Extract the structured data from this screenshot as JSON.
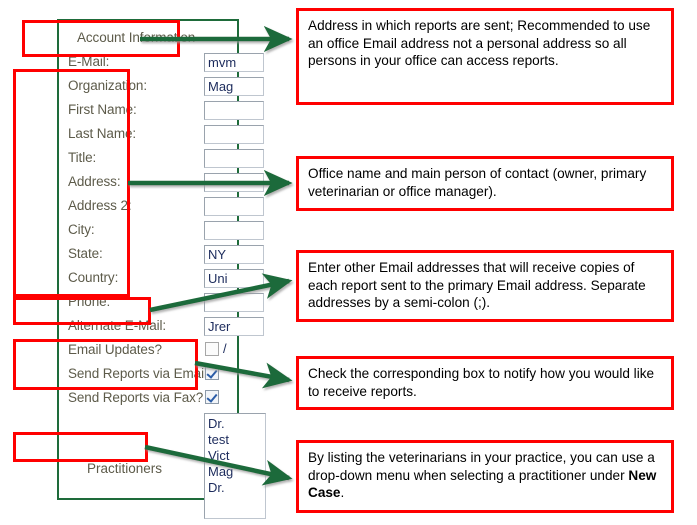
{
  "form": {
    "section_account": "Account Information",
    "section_practitioners": "Practitioners",
    "rows": [
      {
        "label": "E-Mail:",
        "value": "mvm",
        "type": "text"
      },
      {
        "label": "Organization:",
        "value": "Mag",
        "type": "text"
      },
      {
        "label": "First Name:",
        "value": "",
        "type": "text"
      },
      {
        "label": "Last Name:",
        "value": "",
        "type": "text"
      },
      {
        "label": "Title:",
        "value": "",
        "type": "text"
      },
      {
        "label": "Address:",
        "value": "",
        "type": "text"
      },
      {
        "label": "Address 2:",
        "value": "",
        "type": "text"
      },
      {
        "label": "City:",
        "value": "",
        "type": "text"
      },
      {
        "label": "State:",
        "value": "NY",
        "type": "text"
      },
      {
        "label": "Country:",
        "value": "Uni",
        "type": "text"
      },
      {
        "label": "Phone:",
        "value": "",
        "type": "text"
      },
      {
        "label": "Alternate E-Mail:",
        "value": "Jrer",
        "type": "text"
      },
      {
        "label": "Email Updates?",
        "value": "/",
        "type": "checkbox",
        "checked": false
      },
      {
        "label": "Send Reports via Email?",
        "value": "",
        "type": "checkbox",
        "checked": true
      },
      {
        "label": "Send Reports via Fax?",
        "value": "",
        "type": "checkbox",
        "checked": true
      }
    ],
    "practitioner_list": [
      "Dr.",
      "test",
      "Vict",
      "Mag",
      "Dr."
    ]
  },
  "callouts": [
    {
      "id": "callout-email",
      "text": "Address in which reports are sent; Recommended to use an office Email address not a personal address so all persons in your office can access reports."
    },
    {
      "id": "callout-organization",
      "text": "Office name and main person of contact (owner, primary veterinarian or office manager)."
    },
    {
      "id": "callout-alternate-email",
      "text": "Enter other Email addresses that will receive copies of each report sent to the primary Email address. Separate addresses by a semi-colon (;)."
    },
    {
      "id": "callout-send-reports",
      "text": "Check the corresponding box to notify how you would like to receive reports."
    },
    {
      "id": "callout-practitioners",
      "text_before": "By listing the veterinarians in your practice, you can use a drop-down menu when selecting a practitioner under ",
      "text_bold": "New Case",
      "text_after": "."
    }
  ],
  "colors": {
    "annotation_red": "#ff0000",
    "arrow_green": "#1e6b3a",
    "form_border_green": "#1e6b3a",
    "label_text": "#5d5b4a",
    "field_text": "#1c2b5c"
  }
}
